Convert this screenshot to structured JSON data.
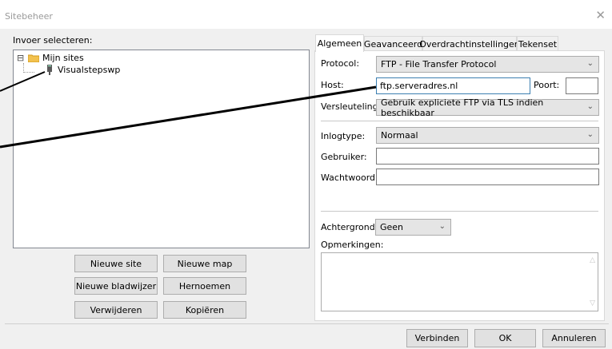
{
  "window": {
    "title": "Sitebeheer",
    "close_glyph": "✕"
  },
  "left": {
    "select_label": "Invoer selecteren:",
    "tree": {
      "root_label": "Mijn sites",
      "root_toggle": "⊟",
      "child_label": "Visualstepswp"
    },
    "buttons": {
      "new_site": "Nieuwe site",
      "new_folder": "Nieuwe map",
      "new_bookmark": "Nieuwe bladwijzer",
      "rename": "Hernoemen",
      "delete": "Verwijderen",
      "copy": "Kopiëren"
    }
  },
  "tabs": [
    "Algemeen",
    "Geavanceerd",
    "Overdrachtinstellingen",
    "Tekenset"
  ],
  "general": {
    "protocol_label": "Protocol:",
    "protocol_value": "FTP - File Transfer Protocol",
    "host_label": "Host:",
    "host_value": "ftp.serveradres.nl",
    "port_label": "Poort:",
    "port_value": "",
    "encryption_label": "Versleuteling:",
    "encryption_value": "Gebruik expliciete FTP via TLS indien beschikbaar",
    "logon_label": "Inlogtype:",
    "logon_value": "Normaal",
    "user_label": "Gebruiker:",
    "user_value": "",
    "password_label": "Wachtwoord:",
    "password_value": "",
    "bgcolor_label": "Achtergrondkleur:",
    "bgcolor_value": "Geen",
    "comments_label": "Opmerkingen:"
  },
  "footer": {
    "connect": "Verbinden",
    "ok": "OK",
    "cancel": "Annuleren"
  },
  "colors": {
    "folder": "#f2c14e",
    "annotation_line": "#000000"
  }
}
